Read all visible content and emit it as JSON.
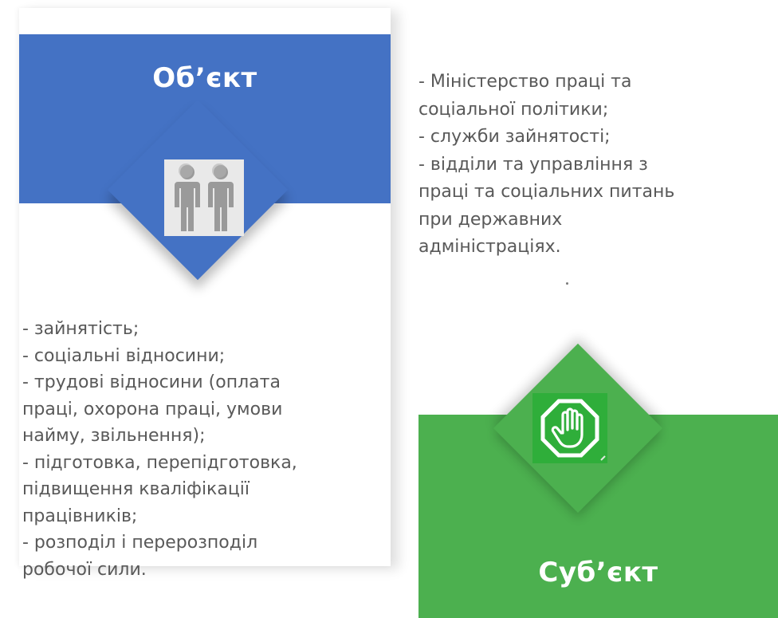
{
  "object": {
    "title": "Об’єкт",
    "icon": "people-icon",
    "color": "#4472c4",
    "items": [
      "- зайнятість;",
      "-  соціальні відносини;",
      "-  трудові відносини (оплата",
      "праці, охорона праці, умови",
      "найму, звільнення);",
      "-  підготовка, перепідготовка,",
      "підвищення кваліфікації",
      "працівників;",
      "-  розподіл і перерозподіл",
      "робочої сили."
    ]
  },
  "subject": {
    "title": "Суб’єкт",
    "icon": "stop-hand-icon",
    "color": "#4cb04f",
    "items": [
      "- Міністерство праці та",
      "соціальної політики;",
      "-  служби зайнятості;",
      "-  відділи та управління з",
      "праці та соціальних питань",
      "при державних",
      "адміністраціях."
    ]
  }
}
